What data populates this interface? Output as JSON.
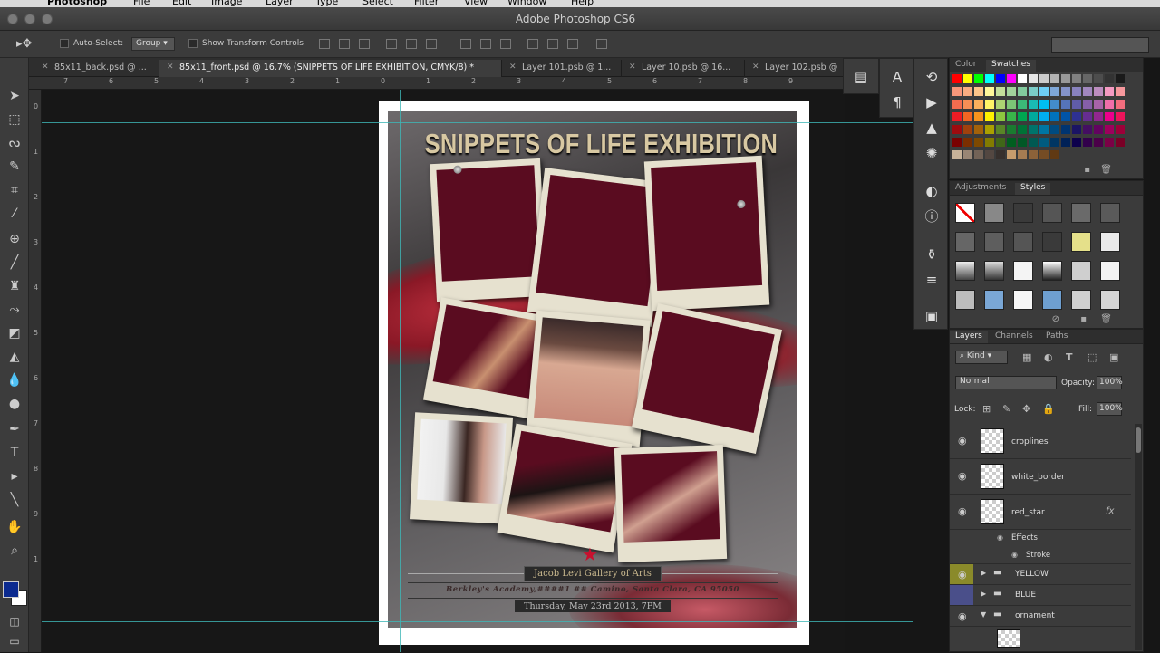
{
  "app": {
    "window_title": "Adobe Photoshop CS6",
    "menu": [
      "Photoshop",
      "File",
      "Edit",
      "Image",
      "Layer",
      "Type",
      "Select",
      "Filter",
      "View",
      "Window",
      "Help"
    ]
  },
  "options_bar": {
    "auto_select_label": "Auto-Select:",
    "auto_select_value": "Group",
    "transform_controls_label": "Show Transform Controls"
  },
  "tabs": [
    {
      "label": "85x11_back.psd @ ..."
    },
    {
      "label": "85x11_front.psd @ 16.7% (SNIPPETS OF LIFE EXHIBITION, CMYK/8) *"
    },
    {
      "label": "Layer 101.psb @ 1..."
    },
    {
      "label": "Layer 10.psb @ 16..."
    },
    {
      "label": "Layer 102.psb @"
    }
  ],
  "rulers": {
    "horizontal": [
      "7",
      "6",
      "5",
      "4",
      "3",
      "2",
      "1",
      "0",
      "1",
      "2",
      "3",
      "4",
      "5",
      "6",
      "7",
      "8",
      "9"
    ],
    "vertical": [
      "0",
      "1",
      "2",
      "3",
      "4",
      "5",
      "6",
      "7",
      "8",
      "9",
      "1"
    ]
  },
  "poster": {
    "title": "SNIPPETS OF LIFE EXHIBITION",
    "gallery": "Jacob Levi Gallery of Arts",
    "address": "Berkley's Academy,####1 ## Camino, Santa Clara, CA 95050",
    "date": "Thursday, May 23rd 2013, 7PM"
  },
  "color_panel": {
    "tabs": [
      "Color",
      "Swatches"
    ],
    "active_tab": "Swatches"
  },
  "styles_panel": {
    "tabs": [
      "Adjustments",
      "Styles"
    ],
    "active_tab": "Styles"
  },
  "layers_panel": {
    "tabs": [
      "Layers",
      "Channels",
      "Paths"
    ],
    "active_tab": "Layers",
    "filter_label": "Kind",
    "blend_mode": "Normal",
    "opacity_label": "Opacity:",
    "opacity_value": "100%",
    "lock_label": "Lock:",
    "fill_label": "Fill:",
    "fill_value": "100%",
    "layers": [
      {
        "name": "croplines"
      },
      {
        "name": "white_border"
      },
      {
        "name": "red_star",
        "fx": "fx"
      }
    ],
    "effects_label": "Effects",
    "stroke_label": "Stroke",
    "groups": [
      {
        "name": "YELLOW",
        "color": "#8a8a2a"
      },
      {
        "name": "BLUE",
        "color": "#4a4f8a"
      },
      {
        "name": "ornament",
        "color": ""
      }
    ]
  },
  "colors": {
    "foreground": "#0b2a8f",
    "background": "#ffffff",
    "guide": "#3fb6b6",
    "poster_title": "#d8c8a2"
  }
}
